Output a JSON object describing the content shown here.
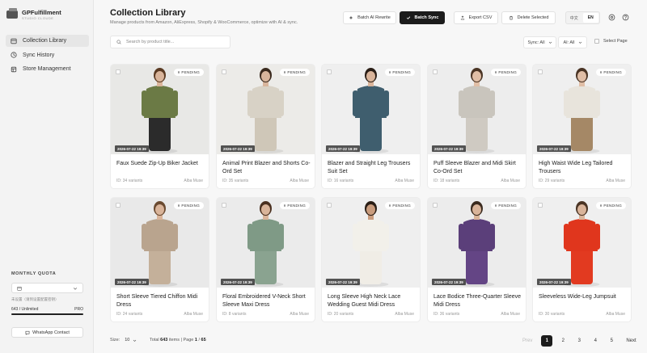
{
  "brand": {
    "name": "GPFulfillment",
    "sub": "STUDIO CLOUDE"
  },
  "nav": [
    {
      "label": "Collection Library",
      "icon": "library-icon",
      "active": true
    },
    {
      "label": "Sync History",
      "icon": "clock-icon",
      "active": false
    },
    {
      "label": "Store Management",
      "icon": "store-icon",
      "active": false
    }
  ],
  "quota": {
    "title": "MONTHLY QUOTA",
    "note": "未设置（请到设置配置密钥）",
    "used": "643 / Unlimited",
    "plan": "PRO"
  },
  "whatsapp_label": "WhatsApp Contact",
  "header": {
    "title": "Collection Library",
    "subtitle": "Manage products from Amazon, AliExpress, Shopify & WooCommerce, optimize with AI & sync.",
    "batch_ai": "Batch AI Rewrite",
    "batch_sync": "Batch Sync",
    "export_csv": "Export CSV",
    "delete_selected": "Delete Selected",
    "lang_zh": "中文",
    "lang_en": "EN"
  },
  "toolbar": {
    "search_placeholder": "Search by product title...",
    "sync_filter": "Sync: All",
    "ai_filter": "AI: All",
    "select_page": "Select Page"
  },
  "products": [
    {
      "title": "Faux Suede Zip-Up Biker Jacket",
      "date": "2026-07-22 19:39",
      "status": "PENDING",
      "variants": "ID: 34 variants",
      "store": "Alba Muse",
      "bg": "#e8e8e6",
      "top": "#6b7a45",
      "bottom": "#2b2b2b",
      "skin": "#d9b49a",
      "hair": "#5a3a22"
    },
    {
      "title": "Animal Print Blazer and Shorts Co-Ord Set",
      "date": "2026-07-22 19:39",
      "status": "PENDING",
      "variants": "ID: 35 variants",
      "store": "Alba Muse",
      "bg": "#ecebe8",
      "top": "#d8d2c6",
      "bottom": "#cfc7b8",
      "skin": "#d8b59c",
      "hair": "#3a2a1e"
    },
    {
      "title": "Blazer and Straight Leg Trousers Suit Set",
      "date": "2026-07-22 19:39",
      "status": "PENDING",
      "variants": "ID: 16 variants",
      "store": "Alba Muse",
      "bg": "#efefef",
      "top": "#3f5e6e",
      "bottom": "#3f5e6e",
      "skin": "#d9b49a",
      "hair": "#2a1e16"
    },
    {
      "title": "Puff Sleeve Blazer and Midi Skirt Co-Ord Set",
      "date": "2026-07-22 19:39",
      "status": "PENDING",
      "variants": "ID: 18 variants",
      "store": "Alba Muse",
      "bg": "#ededed",
      "top": "#c9c5bd",
      "bottom": "#cfcac2",
      "skin": "#e0bea6",
      "hair": "#4a3424"
    },
    {
      "title": "High Waist Wide Leg Tailored Trousers",
      "date": "2026-07-22 19:39",
      "status": "PENDING",
      "variants": "ID: 29 variants",
      "store": "Alba Muse",
      "bg": "#efefef",
      "top": "#e8e4dc",
      "bottom": "#a58866",
      "skin": "#e0bea6",
      "hair": "#4a3424"
    },
    {
      "title": "Short Sleeve Tiered Chiffon Midi Dress",
      "date": "2026-07-22 19:39",
      "status": "PENDING",
      "variants": "ID: 24 variants",
      "store": "Alba Muse",
      "bg": "#e9e9e9",
      "top": "#b9a48e",
      "bottom": "#c4b09a",
      "skin": "#d9b49a",
      "hair": "#6a4a30"
    },
    {
      "title": "Floral Embroidered V-Neck Short Sleeve Maxi Dress",
      "date": "2026-07-22 19:39",
      "status": "PENDING",
      "variants": "ID: 8 variants",
      "store": "Alba Muse",
      "bg": "#ebebeb",
      "top": "#7f9a86",
      "bottom": "#8aa390",
      "skin": "#d9b49a",
      "hair": "#4a3020"
    },
    {
      "title": "Long Sleeve High Neck Lace Wedding Guest Midi Dress",
      "date": "2026-07-22 19:39",
      "status": "PENDING",
      "variants": "ID: 20 variants",
      "store": "Alba Muse",
      "bg": "#efefef",
      "top": "#f2f0ea",
      "bottom": "#f0ede6",
      "skin": "#c99c7e",
      "hair": "#2a1e16"
    },
    {
      "title": "Lace Bodice Three-Quarter Sleeve Midi Dress",
      "date": "2026-07-22 19:39",
      "status": "PENDING",
      "variants": "ID: 36 variants",
      "store": "Alba Muse",
      "bg": "#ececec",
      "top": "#5b3f7a",
      "bottom": "#644585",
      "skin": "#d9b49a",
      "hair": "#3a2a1e"
    },
    {
      "title": "Sleeveless Wide-Leg Jumpsuit",
      "date": "2026-07-22 19:39",
      "status": "PENDING",
      "variants": "ID: 30 variants",
      "store": "Alba Muse",
      "bg": "#efefef",
      "top": "#e0361d",
      "bottom": "#e23a20",
      "skin": "#d9b49a",
      "hair": "#4a3424"
    }
  ],
  "footer": {
    "size_label": "Size:",
    "size_value": "10",
    "total_prefix": "Total",
    "total_count": "643",
    "total_mid": "items | Page",
    "page_current": "1",
    "page_sep": "/",
    "page_total": "65",
    "prev": "Prev",
    "pages": [
      "1",
      "2",
      "3",
      "4",
      "5"
    ],
    "next": "Next"
  },
  "colors": {
    "accent": "#1c1c1c",
    "background": "#f7f7f7",
    "sidebar": "#f3f3f3"
  }
}
